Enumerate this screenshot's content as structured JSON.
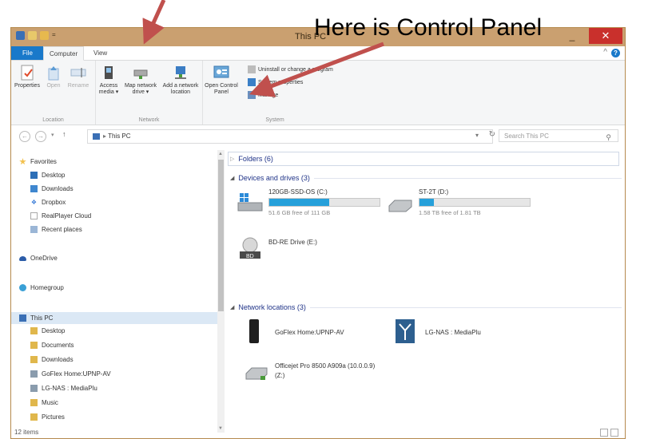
{
  "annotation": {
    "text": "Here is Control Panel",
    "arrow_color": "#c0504d"
  },
  "window": {
    "title": "This PC",
    "min_symbol": "_",
    "close_symbol": "✕"
  },
  "ribbon_tabs": {
    "file": "File",
    "computer": "Computer",
    "view": "View"
  },
  "ribbon": {
    "location": {
      "label": "Location",
      "buttons": [
        "Properties",
        "Open",
        "Rename"
      ]
    },
    "network": {
      "label": "Network",
      "buttons": [
        "Access media ▾",
        "Map network drive ▾",
        "Add a network location"
      ]
    },
    "system": {
      "label": "System",
      "open_control_panel": "Open Control Panel",
      "uninstall": "Uninstall or change a program",
      "system_properties": "System properties",
      "manage": "Manage"
    }
  },
  "address": {
    "path": "This PC",
    "search_placeholder": "Search This PC"
  },
  "nav": {
    "favorites": "Favorites",
    "favorites_items": [
      "Desktop",
      "Downloads",
      "Dropbox",
      "RealPlayer Cloud",
      "Recent places"
    ],
    "onedrive": "OneDrive",
    "homegroup": "Homegroup",
    "this_pc": "This PC",
    "this_pc_items": [
      "Desktop",
      "Documents",
      "Downloads",
      "GoFlex Home:UPNP-AV",
      "LG-NAS : MediaPlu",
      "Music",
      "Pictures"
    ]
  },
  "content": {
    "folders_header": "Folders (6)",
    "devices_header": "Devices and drives (3)",
    "drives": [
      {
        "name": "120GB-SSD-OS (C:)",
        "free": "51.6 GB free of 111 GB",
        "used_fraction": 0.54
      },
      {
        "name": "ST-2T (D:)",
        "free": "1.58 TB free of 1.81 TB",
        "used_fraction": 0.13
      }
    ],
    "bd_drive": "BD-RE Drive (E:)",
    "network_header": "Network locations (3)",
    "network": [
      "GoFlex Home:UPNP-AV",
      "LG-NAS : MediaPlu",
      "Officejet Pro 8500 A909a (10.0.0.9)",
      "(Z:)"
    ]
  },
  "status": {
    "items": "12 items"
  }
}
